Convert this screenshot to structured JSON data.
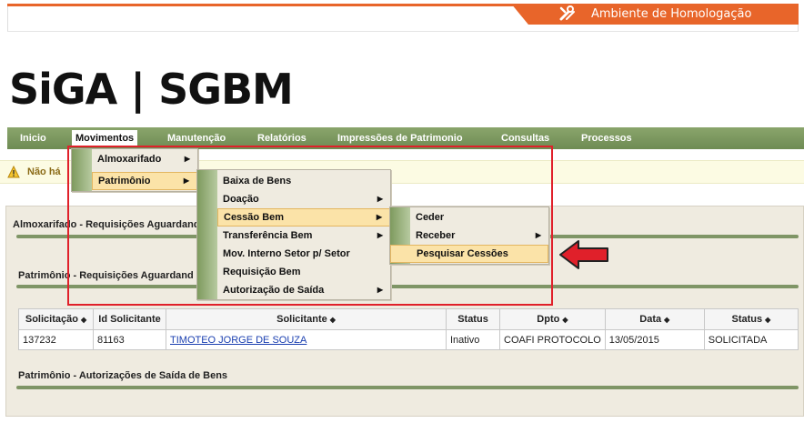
{
  "environment": {
    "label": "Ambiente de Homologação",
    "icon": "tools-icon"
  },
  "logo": {
    "text": "SiGA | SGBM"
  },
  "nav": {
    "items": [
      {
        "label": "Inicio"
      },
      {
        "label": "Movimentos"
      },
      {
        "label": "Manutenção"
      },
      {
        "label": "Relatórios"
      },
      {
        "label": "Impressões de Patrimonio"
      },
      {
        "label": "Consultas"
      },
      {
        "label": "Processos"
      }
    ]
  },
  "warning": {
    "text": "Não há",
    "icon": "warning-icon"
  },
  "menus": {
    "movimentos": [
      {
        "label": "Almoxarifado"
      },
      {
        "label": "Patrimônio"
      }
    ],
    "patrimonio": [
      {
        "label": "Baixa de Bens"
      },
      {
        "label": "Doação"
      },
      {
        "label": "Cessão Bem"
      },
      {
        "label": "Transferência Bem"
      },
      {
        "label": "Mov. Interno Setor p/ Setor"
      },
      {
        "label": "Requisição Bem"
      },
      {
        "label": "Autorização de Saída"
      }
    ],
    "cessao": [
      {
        "label": "Ceder"
      },
      {
        "label": "Receber"
      },
      {
        "label": "Pesquisar Cessões"
      }
    ]
  },
  "sections": {
    "almox": "Almoxarifado - Requisições Aguardand",
    "patrimonio": "Patrimônio - Requisições Aguardand",
    "autorizacoes": "Patrimônio - Autorizações de Saída de Bens"
  },
  "table": {
    "headers": [
      "Solicitação",
      "Id Solicitante",
      "Solicitante",
      "Status",
      "Dpto",
      "Data",
      "Status"
    ],
    "sort_marker": "◆",
    "rows": [
      [
        "137232",
        "81163",
        "TIMOTEO JORGE DE SOUZA",
        "Inativo",
        "COAFI PROTOCOLO",
        "13/05/2015",
        "SOLICITADA"
      ]
    ]
  },
  "colors": {
    "accent": "#e8652a",
    "nav": "#7a965f",
    "highlight": "#fbe3a8",
    "annotation": "#e0202a"
  }
}
